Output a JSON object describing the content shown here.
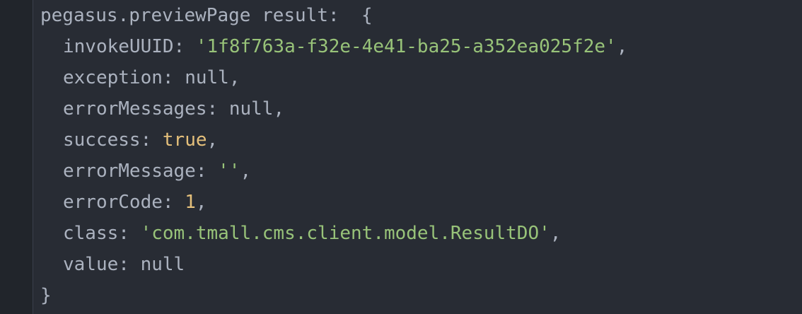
{
  "console": {
    "header": "pegasus.previewPage result:  {",
    "entries": [
      {
        "key": "invokeUUID",
        "value": "'1f8f763a-f32e-4e41-ba25-a352ea025f2e'",
        "type": "string",
        "trailing": ","
      },
      {
        "key": "exception",
        "value": "null",
        "type": "null",
        "trailing": ","
      },
      {
        "key": "errorMessages",
        "value": "null",
        "type": "null",
        "trailing": ","
      },
      {
        "key": "success",
        "value": "true",
        "type": "boolean",
        "trailing": ","
      },
      {
        "key": "errorMessage",
        "value": "''",
        "type": "string",
        "trailing": ","
      },
      {
        "key": "errorCode",
        "value": "1",
        "type": "number",
        "trailing": ","
      },
      {
        "key": "class",
        "value": "'com.tmall.cms.client.model.ResultDO'",
        "type": "string",
        "trailing": ","
      },
      {
        "key": "value",
        "value": "null",
        "type": "null",
        "trailing": ""
      }
    ],
    "footer": "}",
    "colors": {
      "background": "#282c34",
      "text": "#abb2bf",
      "string": "#98c379",
      "boolean": "#e5c07b",
      "number": "#e5c07b"
    }
  }
}
